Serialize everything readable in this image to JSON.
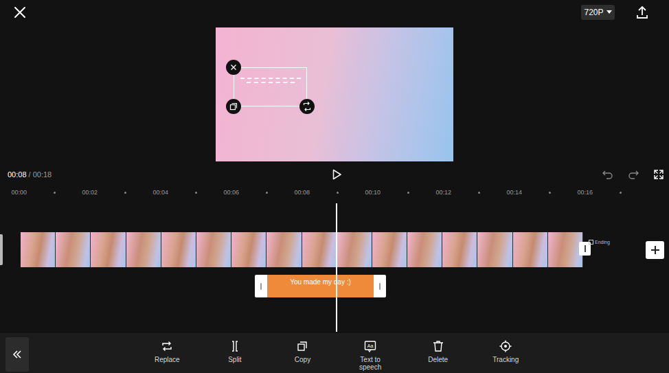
{
  "top_bar": {
    "resolution": "720P"
  },
  "playback": {
    "current": "00:08",
    "separator": "/",
    "total": "00:18"
  },
  "ruler": [
    "00:00",
    "00:02",
    "00:04",
    "00:06",
    "00:08",
    "00:10",
    "00:12",
    "00:14",
    "00:16"
  ],
  "video_track": {
    "frames": 16,
    "ending_label": "Ending"
  },
  "text_clip": {
    "label": "You made my day :)",
    "selected": true
  },
  "toolbar": [
    {
      "label": "Replace"
    },
    {
      "label": "Split"
    },
    {
      "label": "Copy"
    },
    {
      "label": "Text to speech",
      "icon_text": "Aa"
    },
    {
      "label": "Delete"
    },
    {
      "label": "Tracking"
    }
  ]
}
